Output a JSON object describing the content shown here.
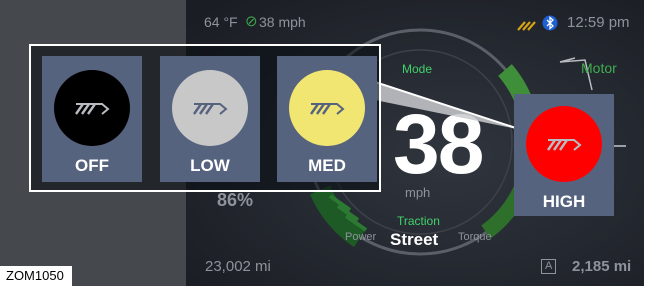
{
  "status_bar": {
    "outside_temp": "64 °F",
    "speed_limit": "38 mph",
    "time": "12:59 pm"
  },
  "gauge": {
    "mode_label": "Mode",
    "speed_value": "38",
    "speed_unit": "mph",
    "traction_label": "Traction",
    "traction_value": "Street",
    "power_label": "Power",
    "torque_label": "Torque"
  },
  "motor": {
    "label": "Motor"
  },
  "battery_percent": "86%",
  "odometer": "23,002 mi",
  "trip": {
    "badge": "A",
    "value": "2,185 mi"
  },
  "heat_modes": [
    {
      "label": "OFF",
      "color": "#000000",
      "selected": false
    },
    {
      "label": "LOW",
      "color": "#c8c8c8",
      "selected": false
    },
    {
      "label": "MED",
      "color": "#f2e672",
      "selected": false
    },
    {
      "label": "HIGH",
      "color": "#ff0000",
      "selected": true
    }
  ],
  "caption": "ZOM1050"
}
